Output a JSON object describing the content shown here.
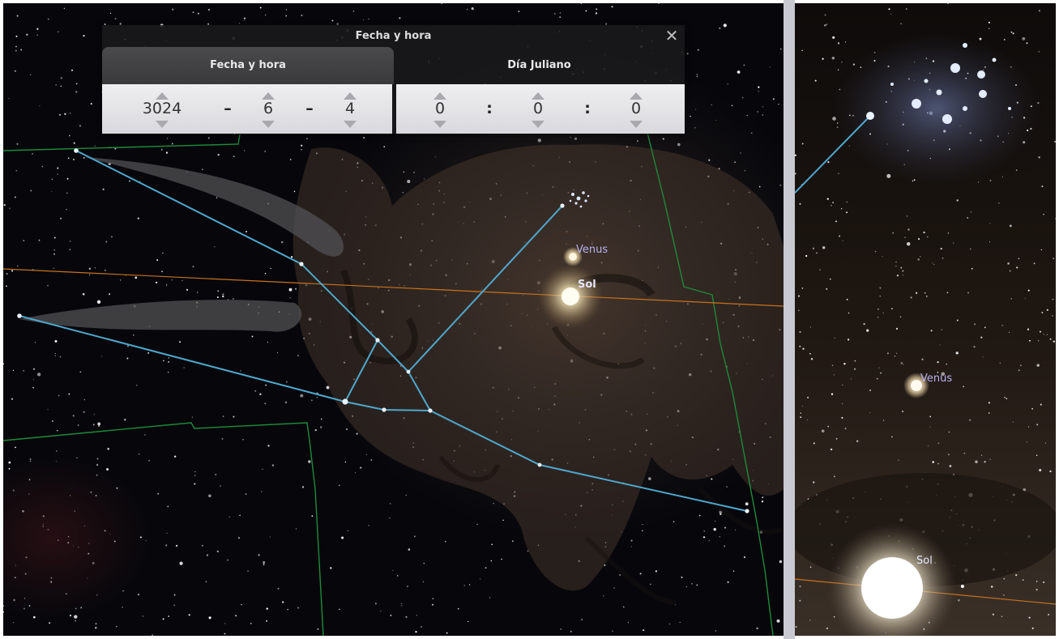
{
  "dialog": {
    "title": "Fecha y hora",
    "close_icon": "close-icon",
    "tabs": [
      {
        "label": "Fecha y hora",
        "active": true
      },
      {
        "label": "Día Juliano",
        "active": false
      }
    ],
    "date": {
      "year": "3024",
      "month": "6",
      "day": "4",
      "separator": "–"
    },
    "time": {
      "hour": "0",
      "minute": "0",
      "second": "0",
      "separator": ":"
    }
  },
  "sky": {
    "main_labels": {
      "venus": "Venus",
      "sun": "Sol"
    },
    "zoom_labels": {
      "venus": "Venus",
      "sun": "Sol"
    },
    "colors": {
      "constellation_line": "#4fa7cc",
      "boundary_line": "#1f8a3a",
      "ecliptic": "#c8721e",
      "label": "#b9b3f0",
      "sun_label": "#e8e8ff"
    }
  }
}
